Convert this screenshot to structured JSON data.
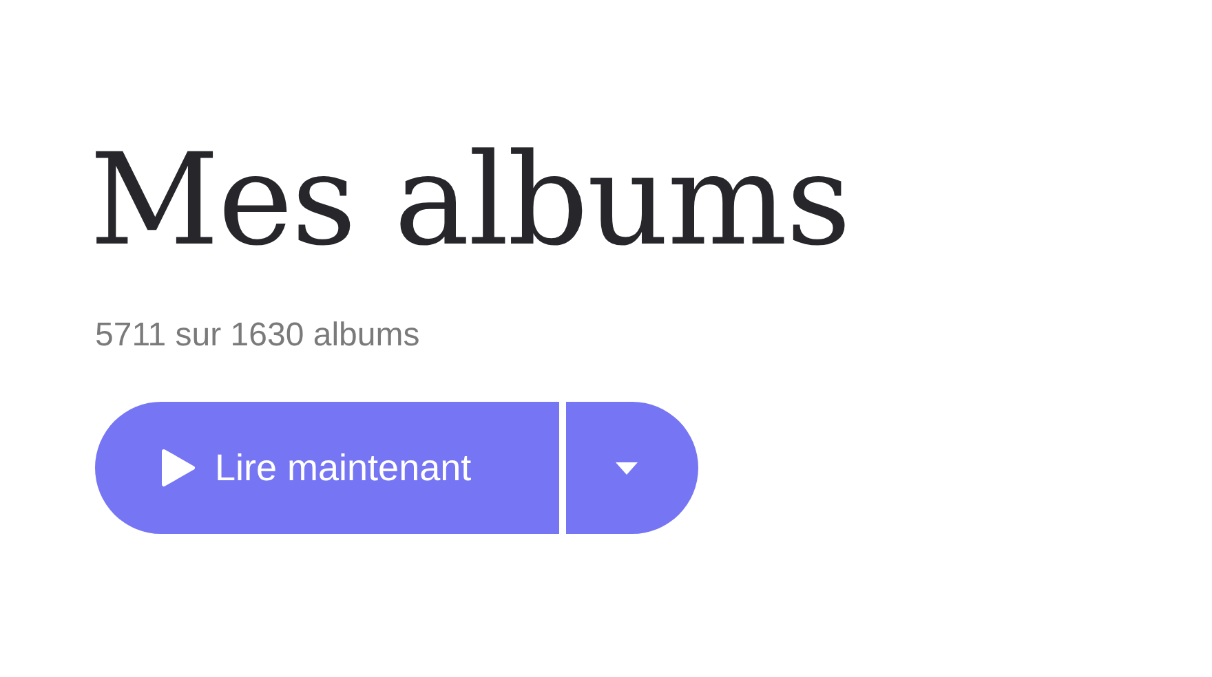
{
  "title": "Mes albums",
  "subtitle": "5711 sur 1630 albums",
  "play_button": {
    "label": "Lire maintenant"
  }
}
